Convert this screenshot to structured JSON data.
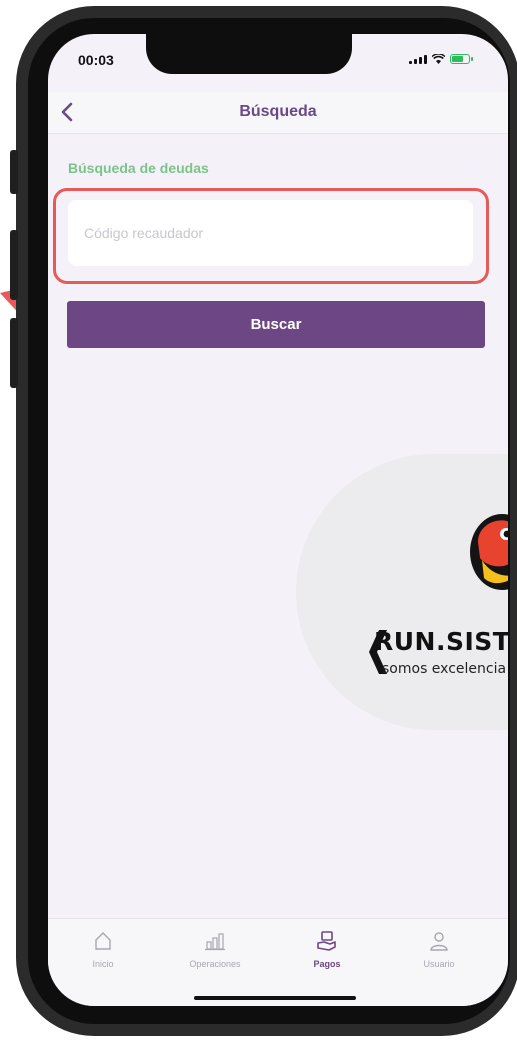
{
  "status_bar": {
    "time": "00:03"
  },
  "header": {
    "back_icon": "chevron-left-icon",
    "title": "Búsqueda"
  },
  "search": {
    "section_label": "Búsqueda de deudas",
    "placeholder": "Código recaudador",
    "value": "",
    "button_label": "Buscar"
  },
  "watermark": {
    "brand": "RUN.SISTE",
    "tagline": "somos excelencia e"
  },
  "tabs": [
    {
      "label": "Inicio",
      "icon": "home-icon",
      "active": false
    },
    {
      "label": "Operaciones",
      "icon": "chart-icon",
      "active": false
    },
    {
      "label": "Pagos",
      "icon": "payment-icon",
      "active": true
    },
    {
      "label": "Usuario",
      "icon": "user-icon",
      "active": false
    }
  ],
  "colors": {
    "accent": "#6d4684",
    "section_label": "#7cc28a",
    "highlight": "#e85a5a"
  }
}
